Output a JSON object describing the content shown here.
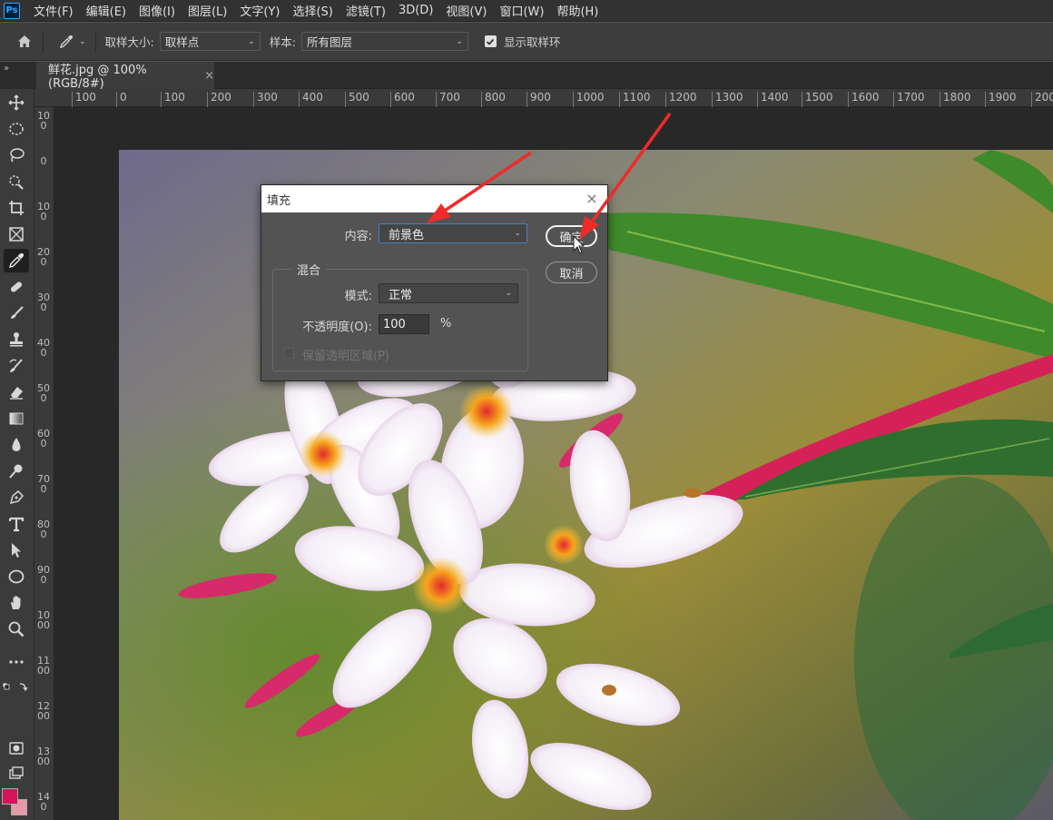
{
  "app": {
    "logo": "Ps"
  },
  "menu": [
    "文件(F)",
    "编辑(E)",
    "图像(I)",
    "图层(L)",
    "文字(Y)",
    "选择(S)",
    "滤镜(T)",
    "3D(D)",
    "视图(V)",
    "窗口(W)",
    "帮助(H)"
  ],
  "options": {
    "sample_size_label": "取样大小:",
    "sample_size_value": "取样点",
    "sample_label": "样本:",
    "sample_value": "所有图层",
    "show_ring_label": "显示取样环"
  },
  "panel_toggle": "»",
  "tab": {
    "title": "鲜花.jpg @ 100%(RGB/8#)",
    "close": "×"
  },
  "ruler_h": [
    "100",
    "0",
    "100",
    "200",
    "300",
    "400",
    "500",
    "600",
    "700",
    "800",
    "900",
    "1000",
    "1100",
    "1200",
    "1300",
    "1400",
    "1500",
    "1600",
    "1700",
    "1800",
    "1900",
    "200"
  ],
  "ruler_v": [
    "100",
    "0",
    "100",
    "200",
    "300",
    "400",
    "500",
    "600",
    "700",
    "800",
    "900",
    "1000",
    "1100",
    "1200",
    "1300",
    "140"
  ],
  "dialog": {
    "title": "填充",
    "close": "×",
    "content_label": "内容:",
    "content_value": "前景色",
    "blend_legend": "混合",
    "mode_label": "模式:",
    "mode_value": "正常",
    "opacity_label": "不透明度(O):",
    "opacity_value": "100",
    "opacity_unit": "%",
    "preserve_label": "保留透明区域(P)",
    "ok_label": "确定",
    "cancel_label": "取消"
  },
  "colors": {
    "foreground": "#d4145a",
    "background": "#e59aa8",
    "annotation_arrow": "#ee2b2b"
  }
}
